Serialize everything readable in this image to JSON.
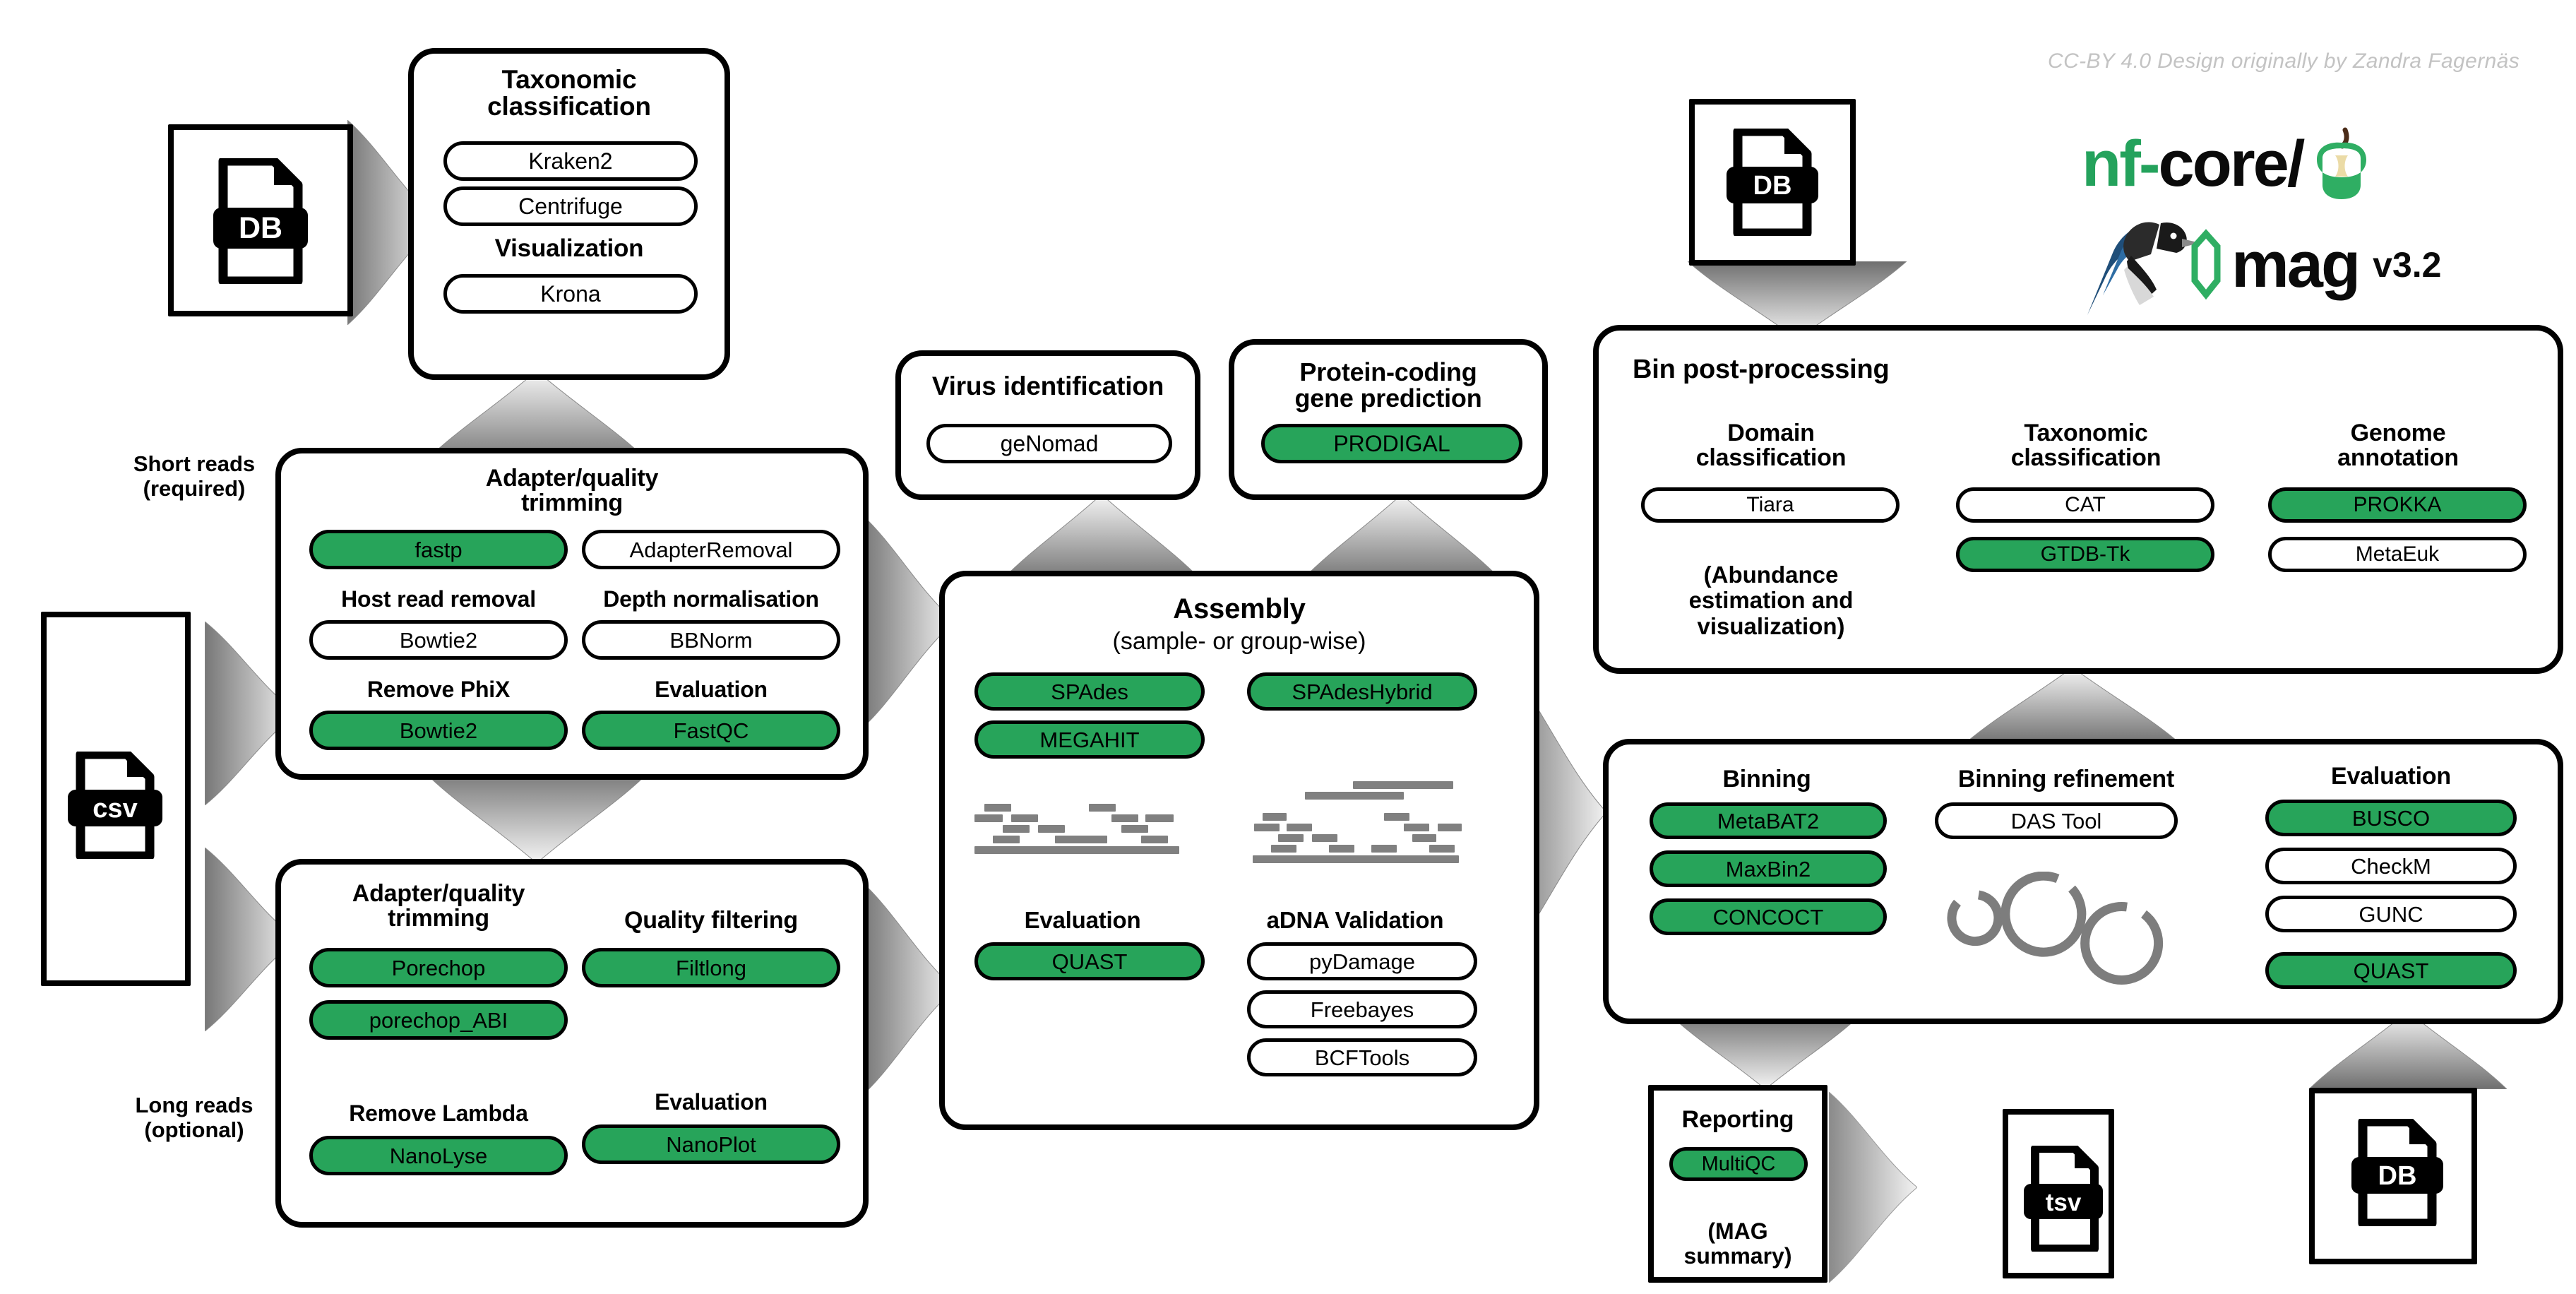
{
  "meta": {
    "credit": "CC-BY 4.0 Design originally by Zandra Fagernäs",
    "logo_nf": "nf-",
    "logo_core": "core/",
    "logo_mag": "mag",
    "version": "v3.2",
    "accent_green": "#27a45a",
    "outline_black": "#000000",
    "read_grey": "#808080",
    "credit_grey": "#c3c3c3"
  },
  "inputs": {
    "samplesheet": {
      "file_type": "csv"
    },
    "db_taxonomy": {
      "file_type": "DB"
    },
    "db_binpost": {
      "file_type": "DB"
    }
  },
  "outputs": {
    "tsv": {
      "file_type": "tsv"
    },
    "db_eval": {
      "file_type": "DB"
    }
  },
  "labels": {
    "short_reads": "Short reads\n(required)",
    "long_reads": "Long reads\n(optional)"
  },
  "boxes": {
    "taxonomic_classification": {
      "title": "Taxonomic\nclassification",
      "tools": [
        {
          "label": "Kraken2",
          "highlighted": false
        },
        {
          "label": "Centrifuge",
          "highlighted": false
        }
      ],
      "subsection": "Visualization",
      "subsection_tools": [
        {
          "label": "Krona",
          "highlighted": false
        }
      ]
    },
    "short_read_preprocessing": {
      "headings": {
        "adapter_trimming": "Adapter/quality\ntrimming",
        "host_read_removal": "Host read removal",
        "depth_normalisation": "Depth normalisation",
        "remove_phix": "Remove PhiX",
        "evaluation": "Evaluation"
      },
      "tools": [
        {
          "label": "fastp",
          "highlighted": true
        },
        {
          "label": "AdapterRemoval",
          "highlighted": false
        },
        {
          "label": "Bowtie2",
          "highlighted": false
        },
        {
          "label": "BBNorm",
          "highlighted": false
        },
        {
          "label": "Bowtie2",
          "highlighted": true
        },
        {
          "label": "FastQC",
          "highlighted": true
        }
      ]
    },
    "long_read_preprocessing": {
      "headings": {
        "adapter_trimming": "Adapter/quality\ntrimming",
        "quality_filtering": "Quality filtering",
        "remove_lambda": "Remove Lambda",
        "evaluation": "Evaluation"
      },
      "tools": [
        {
          "label": "Porechop",
          "highlighted": true
        },
        {
          "label": "Filtlong",
          "highlighted": true
        },
        {
          "label": "porechop_ABI",
          "highlighted": true
        },
        {
          "label": "NanoLyse",
          "highlighted": true
        },
        {
          "label": "NanoPlot",
          "highlighted": true
        }
      ]
    },
    "virus_identification": {
      "title": "Virus identification",
      "tools": [
        {
          "label": "geNomad",
          "highlighted": false
        }
      ]
    },
    "protein_coding_gene_prediction": {
      "title": "Protein-coding\ngene prediction",
      "tools": [
        {
          "label": "PRODIGAL",
          "highlighted": true
        }
      ]
    },
    "assembly": {
      "title": "Assembly",
      "subtitle": "(sample- or group-wise)",
      "tools": [
        {
          "label": "SPAdes",
          "highlighted": true
        },
        {
          "label": "SPAdesHybrid",
          "highlighted": true
        },
        {
          "label": "MEGAHIT",
          "highlighted": true
        }
      ],
      "headings": {
        "evaluation": "Evaluation",
        "adna_validation": "aDNA Validation"
      },
      "evaluation_tools": [
        {
          "label": "QUAST",
          "highlighted": true
        }
      ],
      "adna_tools": [
        {
          "label": "pyDamage",
          "highlighted": false
        },
        {
          "label": "Freebayes",
          "highlighted": false
        },
        {
          "label": "BCFTools",
          "highlighted": false
        }
      ]
    },
    "bin_post_processing": {
      "title": "Bin post-processing",
      "headings": {
        "domain_classification": "Domain\nclassification",
        "taxonomic_classification": "Taxonomic\nclassification",
        "genome_annotation": "Genome\nannotation"
      },
      "note": "(Abundance\nestimation and\nvisualization)",
      "domain_tools": [
        {
          "label": "Tiara",
          "highlighted": false
        }
      ],
      "taxonomic_tools": [
        {
          "label": "CAT",
          "highlighted": false
        },
        {
          "label": "GTDB-Tk",
          "highlighted": true
        }
      ],
      "annotation_tools": [
        {
          "label": "PROKKA",
          "highlighted": true
        },
        {
          "label": "MetaEuk",
          "highlighted": false
        }
      ]
    },
    "binning": {
      "headings": {
        "binning": "Binning",
        "binning_refinement": "Binning refinement",
        "evaluation": "Evaluation"
      },
      "binning_tools": [
        {
          "label": "MetaBAT2",
          "highlighted": true
        },
        {
          "label": "MaxBin2",
          "highlighted": true
        },
        {
          "label": "CONCOCT",
          "highlighted": true
        }
      ],
      "refinement_tools": [
        {
          "label": "DAS Tool",
          "highlighted": false
        }
      ],
      "evaluation_tools": [
        {
          "label": "BUSCO",
          "highlighted": true
        },
        {
          "label": "CheckM",
          "highlighted": false
        },
        {
          "label": "GUNC",
          "highlighted": false
        },
        {
          "label": "QUAST",
          "highlighted": true
        }
      ]
    },
    "reporting": {
      "title": "Reporting",
      "tools": [
        {
          "label": "MultiQC",
          "highlighted": true
        }
      ],
      "note": "(MAG summary)"
    }
  }
}
